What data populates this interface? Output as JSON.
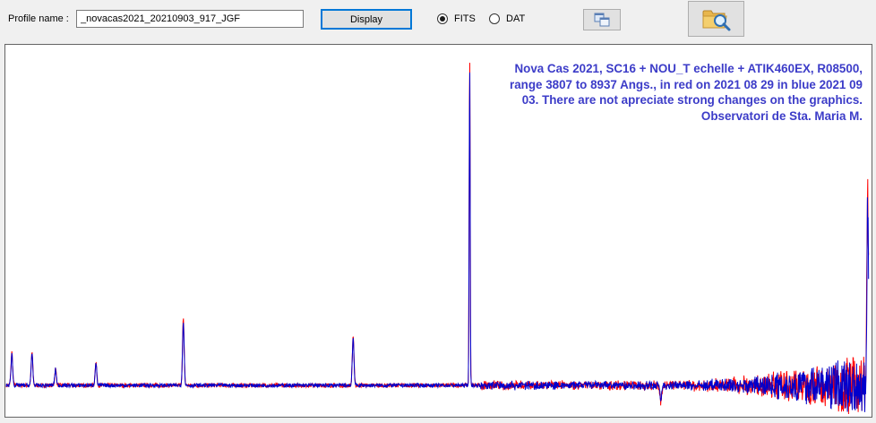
{
  "toolbar": {
    "profile_label": "Profile name :",
    "profile_value": "_novacas2021_20210903_917_JGF",
    "display_label": "Display",
    "radio_fits_label": "FITS",
    "radio_dat_label": "DAT",
    "selected_format": "FITS",
    "copy_icon": "copy-windows-icon",
    "browse_icon": "folder-search-icon"
  },
  "plot": {
    "annotation_lines": [
      "Nova Cas 2021, SC16 + NOU_T echelle + ATIK460EX, R08500,",
      "range 3807 to 8937 Angs., in red on 2021 08 29 in blue 2021 09",
      "03.  There are not apreciate strong changes on the graphics.",
      "Observatori de Sta. Maria M."
    ],
    "colors": {
      "annotation": "#3c3cc8",
      "blue_series": "#0000cc",
      "red_series": "#ff0000"
    }
  },
  "chart_data": {
    "type": "line",
    "xlim": [
      3807,
      8937
    ],
    "series": [
      {
        "name": "2021 08 29",
        "color": "#ff0000"
      },
      {
        "name": "2021 09 03",
        "color": "#0000cc"
      }
    ],
    "features": [
      {
        "x": 3840,
        "y": 0.1
      },
      {
        "x": 3960,
        "y": 0.1
      },
      {
        "x": 4100,
        "y": 0.05
      },
      {
        "x": 4340,
        "y": 0.07
      },
      {
        "x": 4860,
        "y": 0.2
      },
      {
        "x": 5870,
        "y": 0.15
      },
      {
        "x": 6563,
        "y": 1.0
      },
      {
        "x": 7700,
        "y": -0.05
      },
      {
        "x": 8930,
        "y": 0.55
      }
    ]
  }
}
